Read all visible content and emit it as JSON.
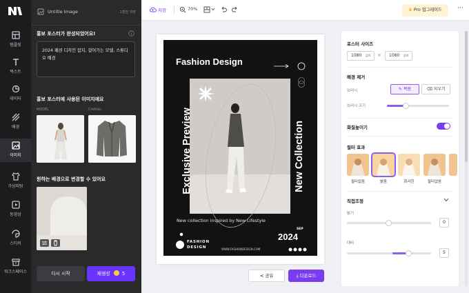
{
  "app": {
    "title": "Untitle Image",
    "save_status": "1편전 저장",
    "brand": "MI"
  },
  "rail": [
    {
      "label": "템플릿",
      "icon": "template-icon"
    },
    {
      "label": "텍스트",
      "icon": "text-icon"
    },
    {
      "label": "데이터",
      "icon": "data-icon"
    },
    {
      "label": "배경",
      "icon": "background-icon"
    },
    {
      "label": "이미지",
      "icon": "image-icon",
      "active": true
    },
    {
      "label": "가상피팅",
      "icon": "shirt-icon"
    },
    {
      "label": "동영상",
      "icon": "video-icon"
    },
    {
      "label": "스티커",
      "icon": "sticker-icon"
    },
    {
      "label": "워크스페이스",
      "icon": "workspace-icon"
    }
  ],
  "panel": {
    "complete_title": "홍보 포스터가 완성되었어요!",
    "prompt": "2024 패션 디자인 잡지, 걸어가는 모델, 스튜디오 배경",
    "used_images_title": "홍보 포스터에 사용된 이미지에요",
    "thumb_label_model": "MODEL",
    "thumb_label_clothes": "Clothes",
    "bg_title": "원하는 배경으로 변경할 수 있어요",
    "retry_label": "다시 시작",
    "regen_label": "재생성",
    "regen_count": "5"
  },
  "toolbar": {
    "save_label": "저장",
    "zoom": "70%",
    "pro_label": "Pro 업그레이드"
  },
  "poster": {
    "title": "Fashion Design",
    "vertical_left": "Exclusive Preview",
    "vertical_right": "New Collection",
    "tagline": "New collection Inspired by New Lifestyle",
    "month": "SEP",
    "year": "2024",
    "brand_line1": "FASHION",
    "brand_line2": "DESIGN",
    "website": "WWW.FASHIONDESIGN.COM"
  },
  "actions": {
    "share_label": "공유",
    "download_label": "다운로드"
  },
  "right": {
    "poster_size_title": "포스터 사이즈",
    "width": "1080",
    "height": "1080",
    "unit": "px",
    "bg_remove_title": "배경 제거",
    "brush_label": "브러시",
    "restore_label": "복원",
    "erase_label": "지우기",
    "brush_size_label": "브러시 크기",
    "brush_size_level": 0.3,
    "sharpen_label": "화질높이기",
    "sharpen_on": true,
    "filter_title": "필터 효과",
    "filters": [
      "필터없음",
      "밝음",
      "화사한",
      "필터없음"
    ],
    "selected_filter": 1,
    "direct_title": "직접조정",
    "brightness_label": "밝기",
    "brightness_value": "0",
    "contrast_label": "대비",
    "contrast_value": "5"
  },
  "colors": {
    "accent": "#7b3cf0",
    "rail_bg": "#1c1c1e",
    "panel_bg": "#2a2a2d"
  }
}
